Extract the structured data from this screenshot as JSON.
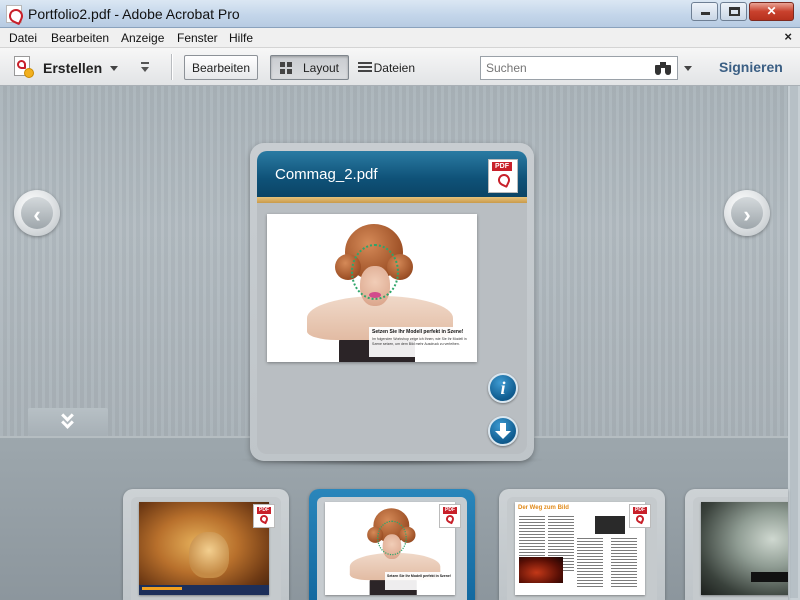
{
  "window": {
    "title": "Portfolio2.pdf - Adobe Acrobat Pro",
    "app_icon": "acrobat-icon",
    "buttons": {
      "minimize": "minimize-icon",
      "maximize": "maximize-icon",
      "close_glyph": "✕"
    }
  },
  "menu": {
    "items": [
      {
        "label": "Datei",
        "name": "menu-datei"
      },
      {
        "label": "Bearbeiten",
        "name": "menu-bearbeiten"
      },
      {
        "label": "Anzeige",
        "name": "menu-anzeige"
      },
      {
        "label": "Fenster",
        "name": "menu-fenster"
      },
      {
        "label": "Hilfe",
        "name": "menu-hilfe"
      }
    ],
    "close_glyph": "×"
  },
  "toolbar": {
    "create_label": "Erstellen",
    "edit_label": "Bearbeiten",
    "view_layout_label": "Layout",
    "view_files_label": "Dateien",
    "active_view": "Layout",
    "search_placeholder": "Suchen",
    "sign_label": "Signieren"
  },
  "portfolio": {
    "current_file": {
      "name": "Commag_2.pdf",
      "badge": "PDF",
      "thumbnail_caption_title": "Setzen Sie Ihr Modell perfekt in Szene!",
      "thumbnail_caption_text": "Im folgenden Workshop zeige ich Ihnen, wie Sie Ihr Modell in Szene setzen, um dem Bild mehr Ausdruck zu verleihen."
    },
    "thumbnails": [
      {
        "name": "thumbnail-lion",
        "badge": "PDF",
        "selected": false
      },
      {
        "name": "thumbnail-commag-2",
        "badge": "PDF",
        "selected": true,
        "caption": "Setzen Sie Ihr Modell perfekt in Szene!"
      },
      {
        "name": "thumbnail-weg-zum-bild",
        "badge": "PDF",
        "selected": false,
        "title": "Der Weg zum Bild"
      },
      {
        "name": "thumbnail-flower",
        "badge": "",
        "selected": false
      }
    ]
  },
  "colors": {
    "card_header": "#0f5278",
    "selected_thumbnail": "#1369a0",
    "sign_link": "#3b5f84",
    "acrobat_red": "#c8202a"
  }
}
